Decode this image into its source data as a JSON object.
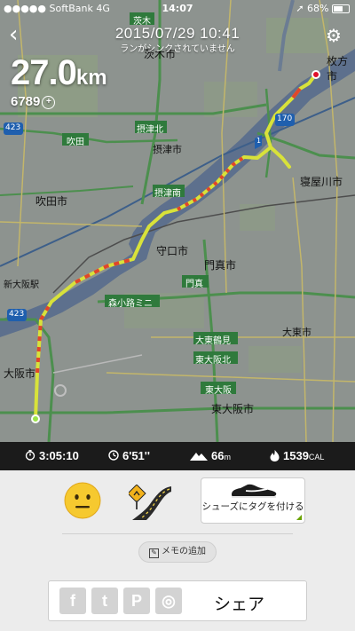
{
  "status": {
    "carrier": "●●●●● SoftBank  4G",
    "time": "14:07",
    "battery": "68%"
  },
  "header": {
    "date": "2015/07/29  10:41",
    "sync_notice": "ランがシンクされていません"
  },
  "run": {
    "distance": "27.0",
    "distance_unit": "km",
    "fuel": "6789"
  },
  "map_labels": {
    "hirakata": "枚方市",
    "ibaraki": "茨木市",
    "neyagawa": "寝屋川市",
    "suita": "吹田市",
    "moriguchi": "守口市",
    "kadoma": "門真市",
    "higashiosaka": "東大阪市",
    "settsu": "摂津市",
    "daito": "大東市",
    "osaka": "大阪市",
    "shin_osaka": "新大阪駅",
    "sign_settsukita": "摂津北",
    "sign_settsuminami": "摂津南",
    "sign_morikoji": "森小路ミニ",
    "sign_kadoma": "門真",
    "sign_daitotsurumi": "大東鶴見",
    "sign_higashiosakakita": "東大阪北",
    "sign_higashiosaka": "東大阪",
    "sign_suita": "吹田",
    "sign_ibaraki": "茨木",
    "route_423a": "423",
    "route_423b": "423",
    "route_170": "170",
    "route_1": "1"
  },
  "stats": {
    "duration": "3:05:10",
    "pace": "6'51''",
    "elevation": "66",
    "elevation_unit": "m",
    "calories": "1539",
    "calories_unit": "CAL"
  },
  "actions": {
    "shoe_tag_label": "シューズにタグを付ける",
    "memo_label": "メモの追加",
    "share_label": "シェア"
  },
  "share_icons": {
    "facebook": "f",
    "twitter": "t",
    "pinterest": "P",
    "instagram": "◎"
  },
  "colors": {
    "route_fast": "#d8e23a",
    "route_slow": "#e0452a",
    "stats_bar": "#1b1b1b",
    "shoe_accent": "#6aa300"
  }
}
